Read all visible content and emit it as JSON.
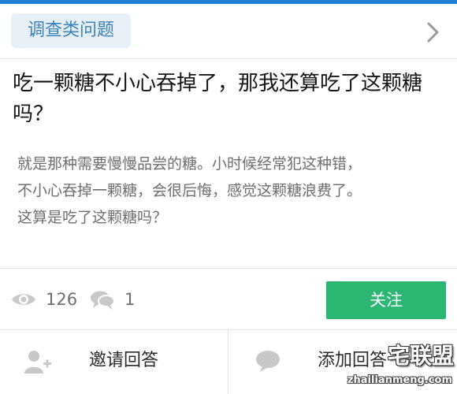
{
  "category": {
    "label": "调查类问题"
  },
  "question": {
    "title": "吃一颗糖不小心吞掉了，那我还算吃了这颗糖吗？",
    "description_lines": [
      "就是那种需要慢慢品尝的糖。小时候经常犯这种错，",
      "不小心吞掉一颗糖，会很后悔，感觉这颗糖浪费了。",
      "这算是吃了这颗糖吗？"
    ]
  },
  "stats": {
    "views": "126",
    "comments": "1",
    "follow_label": "关注"
  },
  "actions": {
    "invite_label": "邀请回答",
    "add_label": "添加回答"
  },
  "watermark": {
    "title": "宅联盟",
    "url": "zhailianmeng.com"
  },
  "colors": {
    "accent_blue": "#1e7fd6",
    "follow_green": "#2bb673",
    "tag_bg": "#e7f0f6",
    "tag_text": "#3a83b8"
  },
  "icons": [
    "chevron-right-icon",
    "eye-icon",
    "comment-icon",
    "add-user-icon",
    "speech-bubble-icon"
  ]
}
